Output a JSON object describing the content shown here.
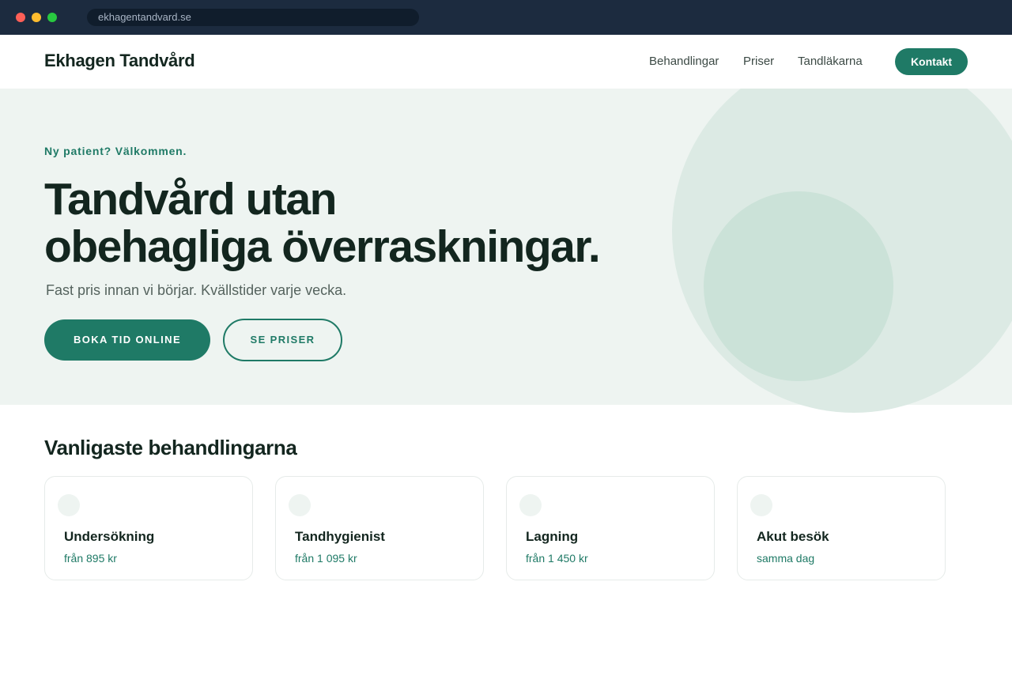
{
  "browser": {
    "url": "ekhagentandvard.se"
  },
  "header": {
    "logo": "Ekhagen Tandvård",
    "nav": [
      "Behandlingar",
      "Priser",
      "Tandläkarna"
    ],
    "contact_label": "Kontakt"
  },
  "hero": {
    "eyebrow": "Ny patient? Välkommen.",
    "title_line1": "Tandvård utan",
    "title_line2": "obehagliga överraskningar.",
    "subtitle": "Fast pris innan vi börjar. Kvällstider varje vecka.",
    "primary_cta": "BOKA TID ONLINE",
    "secondary_cta": "SE PRISER"
  },
  "treatments": {
    "heading": "Vanligaste behandlingarna",
    "items": [
      {
        "title": "Undersökning",
        "price": "från 895 kr"
      },
      {
        "title": "Tandhygienist",
        "price": "från 1 095 kr"
      },
      {
        "title": "Lagning",
        "price": "från 1 450 kr"
      },
      {
        "title": "Akut besök",
        "price": "samma dag"
      }
    ]
  },
  "colors": {
    "accent": "#1f7a66",
    "chrome": "#1c2b3f",
    "hero_bg": "#eef4f1",
    "text": "#13261f"
  }
}
